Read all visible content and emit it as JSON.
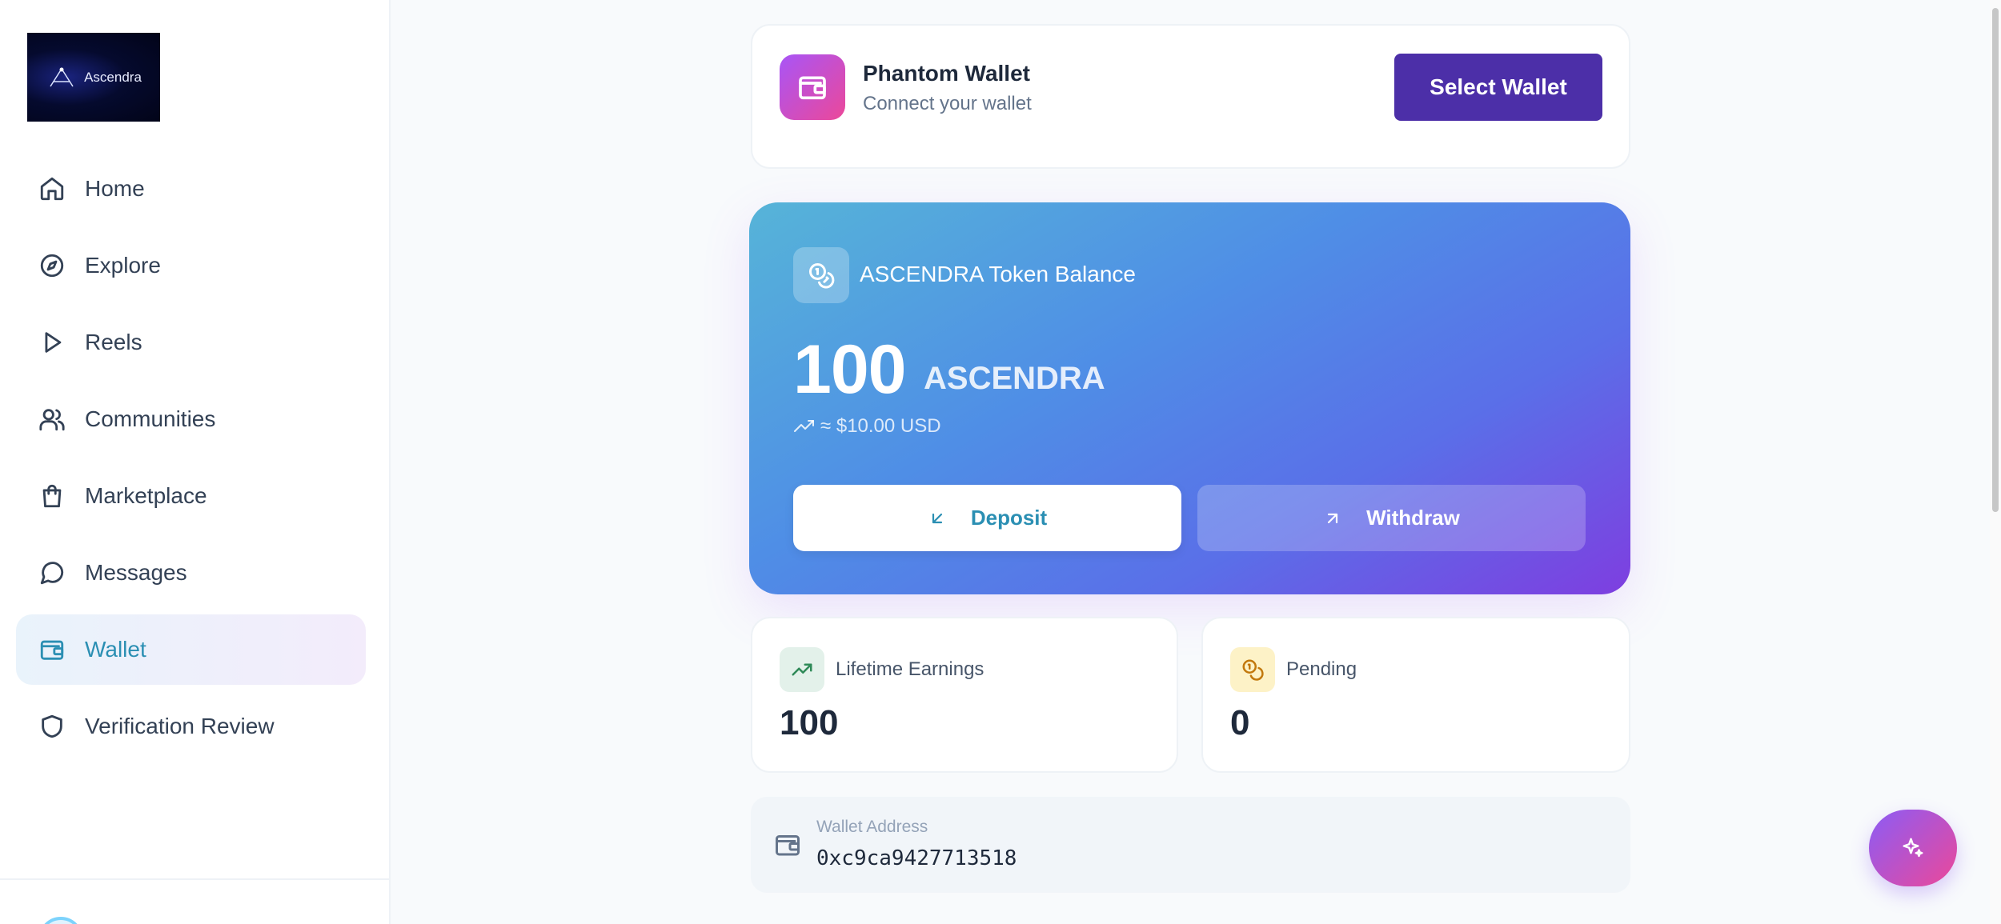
{
  "sidebar": {
    "logo_text": "Ascendra",
    "items": [
      {
        "label": "Home",
        "icon": "home-icon"
      },
      {
        "label": "Explore",
        "icon": "compass-icon"
      },
      {
        "label": "Reels",
        "icon": "play-icon"
      },
      {
        "label": "Communities",
        "icon": "users-icon"
      },
      {
        "label": "Marketplace",
        "icon": "shopping-bag-icon"
      },
      {
        "label": "Messages",
        "icon": "message-circle-icon"
      },
      {
        "label": "Wallet",
        "icon": "wallet-icon",
        "active": true
      },
      {
        "label": "Verification Review",
        "icon": "shield-icon"
      }
    ]
  },
  "connect": {
    "title": "Phantom Wallet",
    "subtitle": "Connect your wallet",
    "button_label": "Select Wallet"
  },
  "balance": {
    "title": "ASCENDRA Token Balance",
    "amount": "100",
    "unit": "ASCENDRA",
    "usd": "≈ $10.00 USD",
    "deposit_label": "Deposit",
    "withdraw_label": "Withdraw"
  },
  "stats": {
    "earnings_label": "Lifetime Earnings",
    "earnings_value": "100",
    "pending_label": "Pending",
    "pending_value": "0"
  },
  "address": {
    "label": "Wallet Address",
    "value": "0xc9ca9427713518"
  },
  "colors": {
    "accent": "#2b8fb3",
    "primary_button": "#4c2fa8",
    "card_gradient_start": "#56b4d8",
    "card_gradient_end": "#7e3ee0"
  }
}
